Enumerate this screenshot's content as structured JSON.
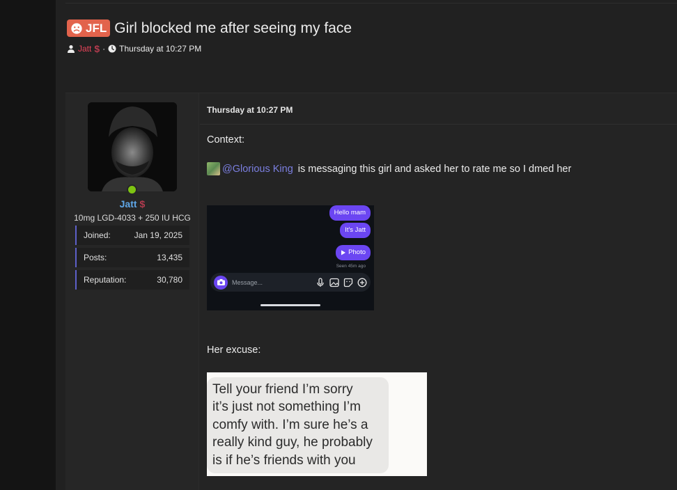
{
  "thread": {
    "prefix": "JFL",
    "title": "Girl blocked me after seeing my face",
    "author": "Jatt",
    "author_badge": "$",
    "separator": "·",
    "date": "Thursday at 10:27 PM"
  },
  "user": {
    "name": "Jatt",
    "badge": "$",
    "title": "10mg LGD-4033 + 250 IU HCG",
    "stats": [
      {
        "label": "Joined:",
        "value": "Jan 19, 2025"
      },
      {
        "label": "Posts:",
        "value": "13,435"
      },
      {
        "label": "Reputation:",
        "value": "30,780"
      }
    ]
  },
  "post": {
    "date": "Thursday at 10:27 PM",
    "context_label": "Context:",
    "mention": "@Glorious King",
    "context_text": " is messaging this girl and asked her to rate me so I dmed her",
    "excuse_label": "Her excuse:"
  },
  "chat_shot": {
    "bubbles": [
      "Hello mam",
      "It's Jatt",
      "Photo"
    ],
    "seen": "Seen 45m ago",
    "placeholder": "Message..."
  },
  "quote_shot": {
    "lines": [
      "Tell your friend I’m sorry",
      "it’s just not something I’m",
      "comfy with. I’m sure he’s a",
      "really kind guy, he probably",
      "is if he’s friends with you"
    ]
  },
  "colors": {
    "prefix_badge": "#e2634c",
    "author_link": "#e8445a",
    "username": "#5fa7e8",
    "mention": "#7b7fe0",
    "online": "#7ec412",
    "chat_bubble": "#6b46f2"
  }
}
